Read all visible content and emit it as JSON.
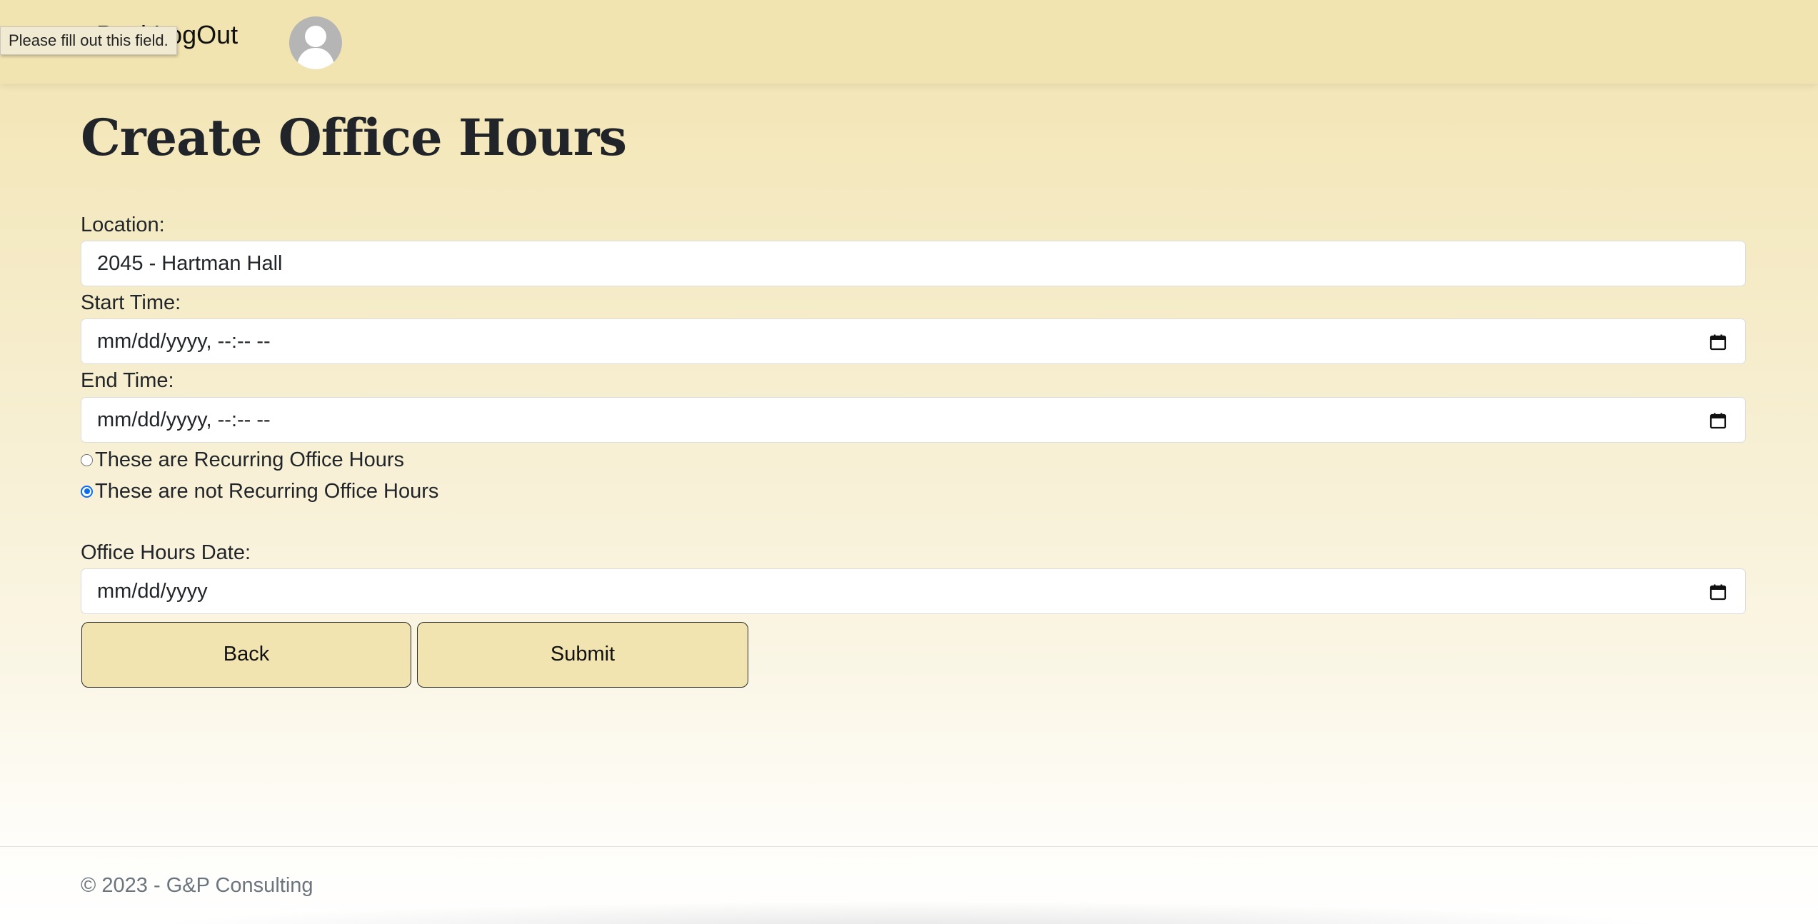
{
  "nav": {
    "links": [
      "Back",
      "LogOut"
    ]
  },
  "tooltip": {
    "text": "Please fill out this field."
  },
  "page": {
    "title": "Create Office Hours"
  },
  "form": {
    "location_label": "Location:",
    "location_value": "2045 - Hartman Hall",
    "start_label": "Start Time:",
    "start_placeholder": "mm/dd/yyyy, --:-- --",
    "end_label": "End Time:",
    "end_placeholder": "mm/dd/yyyy, --:-- --",
    "radio_recurring_label": "These are Recurring Office Hours",
    "radio_not_recurring_label": "These are not Recurring Office Hours",
    "radio_selected": "not_recurring",
    "date_label": "Office Hours Date:",
    "date_placeholder": "mm/dd/yyyy"
  },
  "buttons": {
    "back": "Back",
    "submit": "Submit"
  },
  "footer": {
    "text": "© 2023 - G&P Consulting"
  },
  "colors": {
    "background": "#f2e4b1",
    "accent_radio": "#0b6cf0",
    "footer_text": "#6c757d"
  }
}
